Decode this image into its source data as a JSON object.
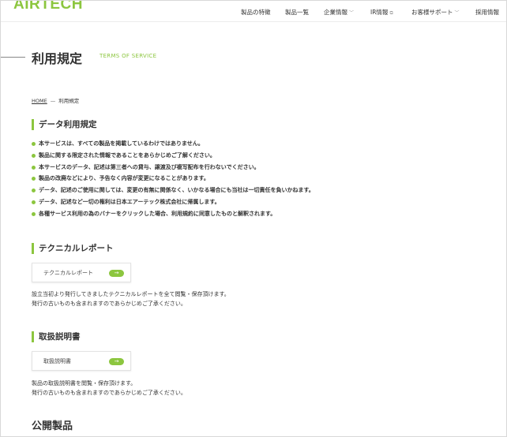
{
  "header": {
    "logo": "AIRTECH",
    "nav": [
      {
        "label": "製品の特徴",
        "suffix": ""
      },
      {
        "label": "製品一覧",
        "suffix": ""
      },
      {
        "label": "企業情報",
        "suffix": "﹀"
      },
      {
        "label": "IR情報",
        "suffix": "⧉"
      },
      {
        "label": "お客様サポート",
        "suffix": "﹀"
      },
      {
        "label": "採用情報",
        "suffix": ""
      }
    ]
  },
  "page": {
    "title": "利用規定",
    "title_en": "TERMS OF SERVICE"
  },
  "breadcrumb": {
    "home": "HOME",
    "separator": "—",
    "current": "利用規定"
  },
  "sections": {
    "data_terms": {
      "heading": "データ利用規定",
      "items": [
        "本サービスは、すべての製品を掲載しているわけではありません。",
        "製品に関する限定された情報であることをあらかじめご了解ください。",
        "本サービスのデータ、記述は第三者への貸与、譲渡及び複写配布を行わないでください。",
        "製品の改廃などにより、予告なく内容が変更になることがあります。",
        "データ、記述のご使用に関しては、変更の有無に関係なく、いかなる場合にも当社は一切責任を負いかねます。",
        "データ、記述など一切の権利は日本エアーテック株式会社に帰属します。",
        "各種サービス利用の為のバナーをクリックした場合、利用規約に同意したものと解釈されます。"
      ]
    },
    "technical_report": {
      "heading": "テクニカルレポート",
      "link_label": "テクニカルレポート",
      "desc_line1": "設立当初より発行してきましたテクニカルレポートを全て閲覧・保存頂けます。",
      "desc_line2": "発行の古いものも含まれますのであらかじめご了承ください。"
    },
    "manual": {
      "heading": "取扱説明書",
      "link_label": "取扱説明書",
      "desc_line1": "製品の取扱説明書を閲覧・保存頂けます。",
      "desc_line2": "発行の古いものも含まれますのであらかじめご了承ください。"
    },
    "public_products": {
      "heading": "公開製品"
    }
  },
  "ui": {
    "arrow_glyph": "→",
    "accent_color": "#8cc63f"
  }
}
